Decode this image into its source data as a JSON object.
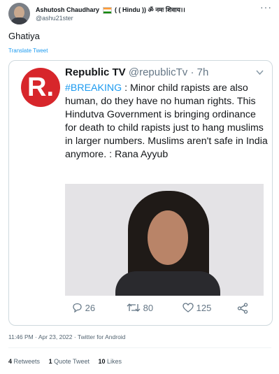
{
  "author": {
    "name": "Ashutosh Chaudhary",
    "name_suffix": "( ( Hindu )) ॐ नमः शिवाय।।",
    "handle": "@ashu21ster"
  },
  "tweet": {
    "text": "Ghatiya",
    "translate_label": "Translate Tweet",
    "time": "11:46 PM · Apr 23, 2022 · Twitter for Android"
  },
  "quoted": {
    "logo_letter": "R.",
    "name": "Republic TV",
    "handle": "@republicTv",
    "age": "· 7h",
    "hashtag": "#BREAKING",
    "body": " : Minor child rapists are also human, do they have no human rights. This Hindutva Government is bringing ordinance for death to child rapists just to hang muslims in larger numbers. Muslims aren't safe in India anymore. : Rana Ayyub",
    "replies": "26",
    "retweets": "80",
    "likes": "125"
  },
  "stats": {
    "retweets_count": "4",
    "retweets_label": "Retweets",
    "quotes_count": "1",
    "quotes_label": "Quote Tweet",
    "likes_count": "10",
    "likes_label": "Likes"
  },
  "icons": {
    "more": "more-icon",
    "chevron": "chevron-down-icon",
    "reply": "reply-icon",
    "retweet": "retweet-icon",
    "like": "heart-icon",
    "share": "share-icon"
  },
  "colors": {
    "link": "#1d9bf0",
    "republic_red": "#d7262b"
  }
}
